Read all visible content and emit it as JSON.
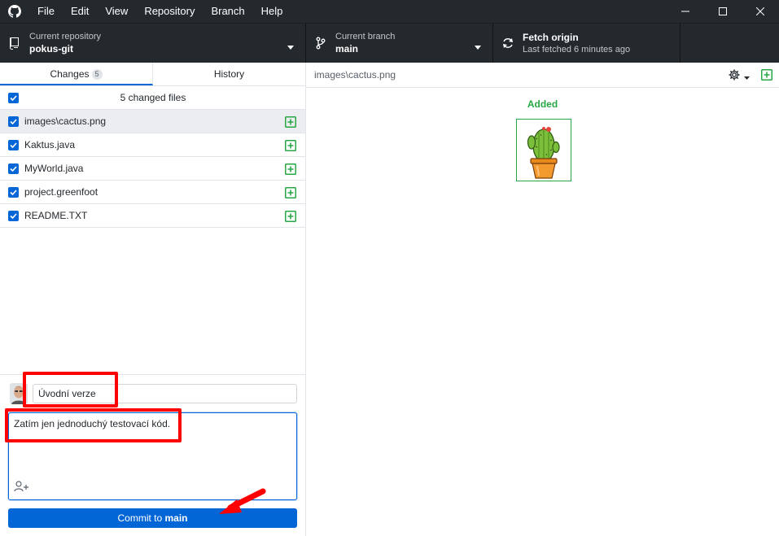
{
  "menu": [
    "File",
    "Edit",
    "View",
    "Repository",
    "Branch",
    "Help"
  ],
  "toolbar": {
    "repo": {
      "title": "Current repository",
      "value": "pokus-git"
    },
    "branch": {
      "title": "Current branch",
      "value": "main"
    },
    "fetch": {
      "title": "Fetch origin",
      "subtitle": "Last fetched 6 minutes ago"
    }
  },
  "tabs": {
    "changes": {
      "label": "Changes",
      "count": "5"
    },
    "history": {
      "label": "History"
    }
  },
  "files": {
    "header": "5 changed files",
    "items": [
      {
        "name": "images\\cactus.png",
        "status": "added",
        "selected": true
      },
      {
        "name": "Kaktus.java",
        "status": "added",
        "selected": false
      },
      {
        "name": "MyWorld.java",
        "status": "added",
        "selected": false
      },
      {
        "name": "project.greenfoot",
        "status": "added",
        "selected": false
      },
      {
        "name": "README.TXT",
        "status": "added",
        "selected": false
      }
    ]
  },
  "commit": {
    "summary": "Úvodní verze",
    "description": "Zatím jen jednoduchý testovací kód.",
    "button_prefix": "Commit to ",
    "button_branch": "main"
  },
  "diff": {
    "path": "images\\cactus.png",
    "status_label": "Added"
  },
  "colors": {
    "accent": "#0366d6",
    "added": "#28a745",
    "annotation": "#ff0000",
    "toolbar_bg": "#24292e"
  }
}
